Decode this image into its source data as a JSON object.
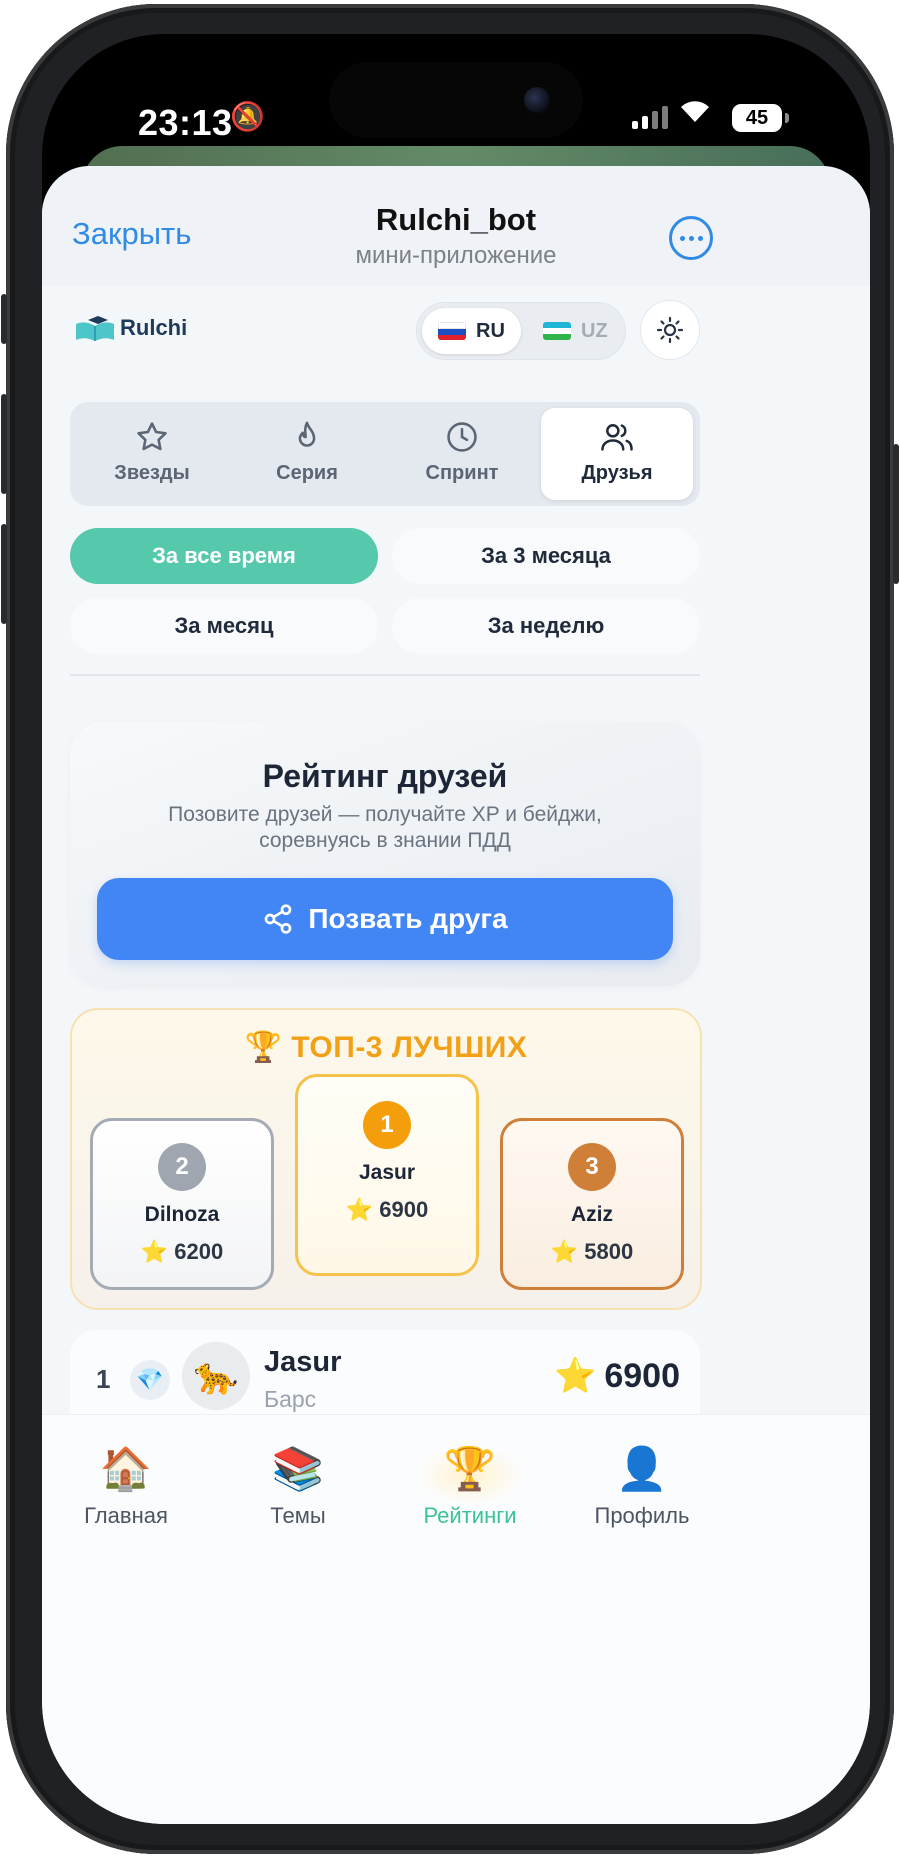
{
  "status_bar": {
    "time": "23:13",
    "battery": "45"
  },
  "telegram": {
    "close_label": "Закрыть",
    "title": "Rulchi_bot",
    "subtitle": "мини-приложение"
  },
  "app": {
    "logo_text": "Rulchi"
  },
  "language": {
    "ru": "RU",
    "uz": "UZ",
    "selected": "RU"
  },
  "tabs": [
    {
      "label": "Звезды",
      "icon": "star-icon"
    },
    {
      "label": "Серия",
      "icon": "flame-icon"
    },
    {
      "label": "Спринт",
      "icon": "clock-icon"
    },
    {
      "label": "Друзья",
      "icon": "users-icon",
      "active": true
    }
  ],
  "periods": [
    {
      "label": "За все время",
      "active": true
    },
    {
      "label": "За 3 месяца"
    },
    {
      "label": "За месяц"
    },
    {
      "label": "За неделю"
    }
  ],
  "invite": {
    "title": "Рейтинг друзей",
    "description": "Позовите друзей — получайте XP и бейджи, соревнуясь в знании ПДД",
    "button_label": "Позвать друга"
  },
  "top3": {
    "title": "ТОП-3 ЛУЧШИХ",
    "players": [
      {
        "rank": "2",
        "name": "Dilnoza",
        "score": "6200"
      },
      {
        "rank": "1",
        "name": "Jasur",
        "score": "6900"
      },
      {
        "rank": "3",
        "name": "Aziz",
        "score": "5800"
      }
    ]
  },
  "leaderboard": [
    {
      "rank": "1",
      "name": "Jasur",
      "level": "Барс",
      "score": "6900"
    }
  ],
  "bottom_nav": [
    {
      "label": "Главная",
      "icon": "house-icon"
    },
    {
      "label": "Темы",
      "icon": "books-icon"
    },
    {
      "label": "Рейтинги",
      "icon": "trophy-icon",
      "active": true
    },
    {
      "label": "Профиль",
      "icon": "profile-icon"
    }
  ],
  "colors": {
    "accent_green": "#56c9ad",
    "primary_blue": "#4285f4",
    "telegram_blue": "#2f8be6",
    "gold": "#f2a016",
    "silver": "#9fa6b0",
    "bronze": "#cf7f38"
  }
}
